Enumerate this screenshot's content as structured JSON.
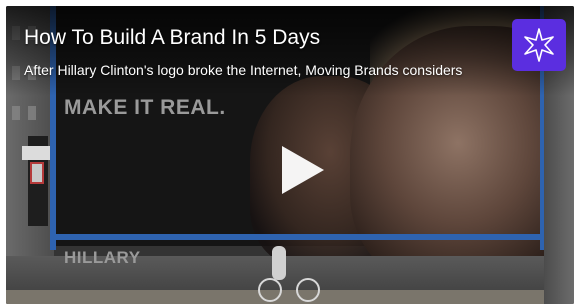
{
  "video": {
    "title": "How To Build A Brand In 5 Days",
    "description": "After Hillary Clinton's logo broke the Internet, Moving Brands considers",
    "billboard_slogan": "MAKE IT REAL.",
    "billboard_name": "HILLARY"
  },
  "icons": {
    "play": "play-icon",
    "brand": "starburst-logo-icon"
  },
  "colors": {
    "brand_badge": "#5b2ee0",
    "billboard_frame": "#2e63b0",
    "title_text": "#ffffff"
  }
}
